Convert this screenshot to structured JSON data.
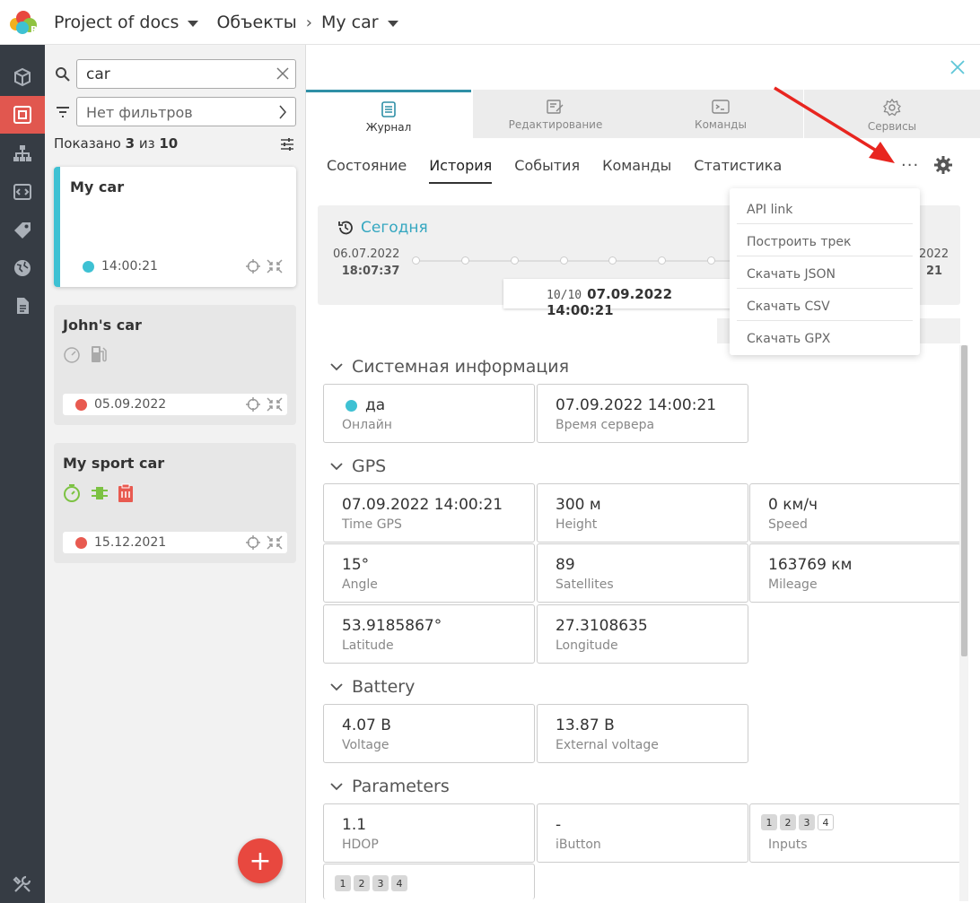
{
  "breadcrumb": {
    "project": "Project of docs",
    "section": "Объекты",
    "object": "My car"
  },
  "sidebar_left": {
    "icons": [
      "cube-icon",
      "objects-icon",
      "hierarchy-icon",
      "code-icon",
      "tag-icon",
      "globe-icon",
      "document-icon",
      "tools-icon"
    ]
  },
  "objects_panel": {
    "search_value": "car",
    "filter_label": "Нет фильтров",
    "count": {
      "prefix": "Показано ",
      "shown": "3",
      "mid": " из ",
      "total": "10"
    },
    "cards": [
      {
        "title": "My car",
        "status_color": "#3ec1d3",
        "time": "14:00:21"
      },
      {
        "title": "John's car",
        "status_color": "#e85a50",
        "time": "05.09.2022"
      },
      {
        "title": "My sport car",
        "status_color": "#e85a50",
        "time": "15.12.2021"
      }
    ],
    "fab_label": "+"
  },
  "tabs": [
    {
      "label": "Журнал",
      "icon": "journal-icon"
    },
    {
      "label": "Редактирование",
      "icon": "edit-icon"
    },
    {
      "label": "Команды",
      "icon": "terminal-icon"
    },
    {
      "label": "Сервисы",
      "icon": "settings-icon"
    }
  ],
  "subtabs": [
    "Состояние",
    "История",
    "События",
    "Команды",
    "Статистика"
  ],
  "timeline": {
    "heading": "Сегодня",
    "start_date": "06.07.2022",
    "start_time": "18:07:37",
    "current_index": "10/10",
    "current": "07.09.2022 14:00:21",
    "end_date_partial": "2022",
    "end_time_partial": "21"
  },
  "menu": [
    "API link",
    "Построить трек",
    "Скачать JSON",
    "Скачать CSV",
    "Скачать GPX"
  ],
  "sections": {
    "system": {
      "title": "Системная информация",
      "cells": [
        {
          "value": "да",
          "label": "Онлайн"
        },
        {
          "value": "07.09.2022 14:00:21",
          "label": "Время сервера"
        }
      ]
    },
    "gps": {
      "title": "GPS",
      "cells": [
        {
          "value": "07.09.2022 14:00:21",
          "label": "Time GPS"
        },
        {
          "value": "300 м",
          "label": "Height"
        },
        {
          "value": "0 км/ч",
          "label": "Speed"
        },
        {
          "value": "15°",
          "label": "Angle"
        },
        {
          "value": "89",
          "label": "Satellites"
        },
        {
          "value": "163769 км",
          "label": "Mileage"
        },
        {
          "value": "53.9185867°",
          "label": "Latitude"
        },
        {
          "value": "27.3108635",
          "label": "Longitude"
        }
      ]
    },
    "battery": {
      "title": "Battery",
      "cells": [
        {
          "value": "4.07 В",
          "label": "Voltage"
        },
        {
          "value": "13.87 В",
          "label": "External voltage"
        }
      ]
    },
    "parameters": {
      "title": "Parameters",
      "cells": [
        {
          "value": "1.1",
          "label": "HDOP"
        },
        {
          "value": "-",
          "label": "iButton"
        },
        {
          "value": "",
          "label": "Inputs",
          "badges": [
            "1",
            "2",
            "3",
            "4"
          ]
        },
        {
          "value": "",
          "label": "",
          "badges": [
            "1",
            "2",
            "3",
            "4"
          ]
        }
      ]
    }
  },
  "colors": {
    "accent": "#3ec1d3",
    "active_nav": "#e1574f",
    "sidebar": "#363c44",
    "arrow": "#e8251f"
  }
}
